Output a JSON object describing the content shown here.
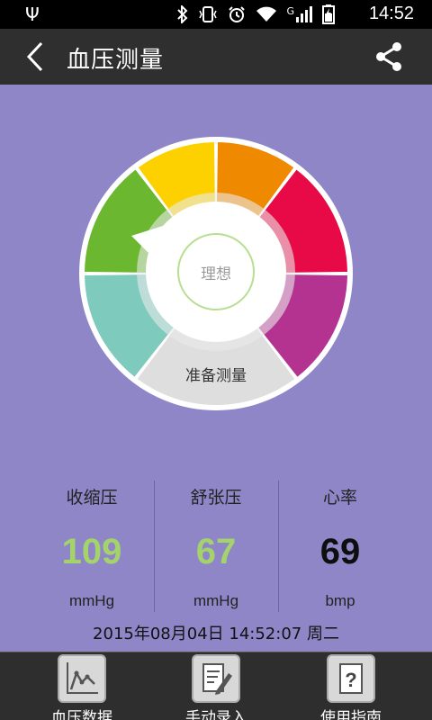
{
  "status_bar": {
    "time": "14:52",
    "signal_indicator": "G",
    "icons": [
      "usb-icon",
      "bluetooth-icon",
      "vibrate-icon",
      "alarm-icon",
      "wifi-icon",
      "signal-icon",
      "battery-icon"
    ]
  },
  "app_bar": {
    "title": "血压测量",
    "back_icon": "chevron-left-icon",
    "share_icon": "share-icon"
  },
  "gauge": {
    "center_label": "理想",
    "bottom_label": "准备测量",
    "segments": [
      {
        "name": "low-left",
        "color": "#7ecbbe"
      },
      {
        "name": "ideal",
        "color": "#6bb72f"
      },
      {
        "name": "normal",
        "color": "#fdd100"
      },
      {
        "name": "high-normal",
        "color": "#ef8a00"
      },
      {
        "name": "mild",
        "color": "#e80a46"
      },
      {
        "name": "moderate",
        "color": "#b43391"
      }
    ],
    "track_color": "#dedede",
    "ring_color": "#ffffff"
  },
  "readings": [
    {
      "label": "收缩压",
      "value": "109",
      "unit": "mmHg",
      "color": "#a4d36b"
    },
    {
      "label": "舒张压",
      "value": "67",
      "unit": "mmHg",
      "color": "#a4d36b"
    },
    {
      "label": "心率",
      "value": "69",
      "unit": "bmp",
      "color": "#0e0e0e"
    }
  ],
  "timestamp": "2015年08月04日 14:52:07 周二",
  "bottom_nav": [
    {
      "label": "血压数据",
      "icon": "chart-icon"
    },
    {
      "label": "手动录入",
      "icon": "edit-icon"
    },
    {
      "label": "使用指南",
      "icon": "help-icon"
    }
  ]
}
